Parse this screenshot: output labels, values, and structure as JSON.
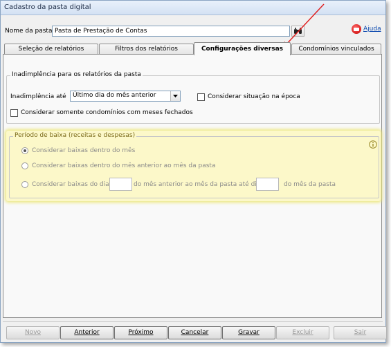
{
  "window": {
    "title": "Cadastro da pasta digital"
  },
  "header": {
    "name_label": "Nome da pasta:",
    "name_value": "Pasta de Prestação de Contas",
    "help_label": "Ajuda"
  },
  "tabs": [
    {
      "label": "Seleção de relatórios",
      "active": false
    },
    {
      "label": "Filtros dos relatórios",
      "active": false
    },
    {
      "label": "Configurações diversas",
      "active": true
    },
    {
      "label": "Condomínios vinculados",
      "active": false
    }
  ],
  "delinquency": {
    "group_title": "Inadimplência para os relatórios da pasta",
    "until_label": "Inadimplência até",
    "until_value": "Último dia do mês anterior",
    "consider_status_label": "Considerar situação na época",
    "closed_months_label": "Considerar somente condomínios com meses fechados"
  },
  "write_off": {
    "group_title": "Período de baixa (receitas e despesas)",
    "option1": "Considerar baixas dentro do mês",
    "option2": "Considerar baixas dentro do mês anterior ao mês da pasta",
    "option3_part1": "Considerar baixas do dia",
    "option3_part2": "do mês anterior ao mês da pasta até dia",
    "option3_part3": "do mês da pasta",
    "selected_option": 1
  },
  "buttons": {
    "new": "Novo",
    "previous": "Anterior",
    "next": "Próximo",
    "cancel": "Cancelar",
    "save": "Gravar",
    "delete": "Excluir",
    "exit": "Sair"
  },
  "colors": {
    "highlight": "#fcf8c9",
    "annotation_arrow": "#e02020",
    "link": "#0645ad"
  }
}
